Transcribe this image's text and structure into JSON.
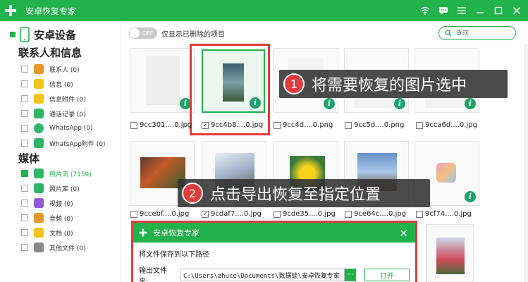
{
  "window": {
    "title": "安卓恢复专家"
  },
  "sidebar": {
    "device_label": "安卓设备",
    "section_contacts": "联系人和信息",
    "section_media": "媒体",
    "contacts_items": [
      {
        "label": "联系人 (0)",
        "color": "#e8952b"
      },
      {
        "label": "信息 (0)",
        "color": "#f0c419"
      },
      {
        "label": "信息附件 (0)",
        "color": "#f0c419"
      },
      {
        "label": "通话记录 (0)",
        "color": "#2fb66a"
      },
      {
        "label": "WhatsApp (0)",
        "color": "#2fb66a"
      },
      {
        "label": "WhatsApp附件 (0)",
        "color": "#2fb66a"
      }
    ],
    "media_items": [
      {
        "label": "照片流 (7159)",
        "color": "#2fb66a"
      },
      {
        "label": "照片库 (0)",
        "color": "#2fb66a"
      },
      {
        "label": "视频 (0)",
        "color": "#8b5bd6"
      },
      {
        "label": "音频 (0)",
        "color": "#e8952b"
      },
      {
        "label": "文档 (0)",
        "color": "#f0c419"
      },
      {
        "label": "其他文件 (0)",
        "color": "#8a8a8a"
      }
    ]
  },
  "toolbar": {
    "toggle_state": "OFF",
    "toggle_label": "仅显示已删除的项目",
    "search_placeholder": "查找"
  },
  "grid": {
    "row1": [
      {
        "name": "9cc301....0.jpg",
        "checked": false
      },
      {
        "name": "9cc4b8....0.jpg",
        "checked": true
      },
      {
        "name": "9cc4d....0.png",
        "checked": false
      },
      {
        "name": "9cc5d....0.png",
        "checked": false
      },
      {
        "name": "9cca6d....0.jpg",
        "checked": false
      }
    ],
    "row2": [
      {
        "name": "9ccebf....0.jpg",
        "checked": false
      },
      {
        "name": "9cdaf7....0.jpg",
        "checked": true
      },
      {
        "name": "9cde35....0.jpg",
        "checked": false
      },
      {
        "name": "9ce64c....0.jpg",
        "checked": false
      },
      {
        "name": "9cf74....0.jpg",
        "checked": false
      }
    ]
  },
  "callouts": {
    "step1_num": "1",
    "step1_text": "将需要恢复的图片选中",
    "step2_num": "2",
    "step2_text": "点击导出恢复至指定位置"
  },
  "dialog": {
    "title": "安卓恢复专家",
    "prompt": "将文件保存到以下路径",
    "folder_label": "输出文件夹:",
    "folder_path": "C:\\Users\\zhuce\\Documents\\数据蛙\\安卓恢复专家",
    "browse_label": "···",
    "open_label": "打开"
  },
  "colors": {
    "brand_green": "#21b24b",
    "highlight_red": "#e23b3b"
  }
}
